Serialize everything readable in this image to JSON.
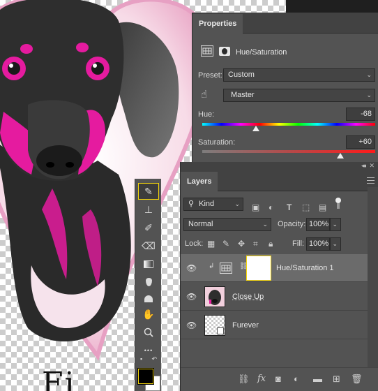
{
  "canvas": {
    "title_fragment": "Fi",
    "colors": {
      "magenta": "#e51b9f",
      "dog": "#2b2b2b",
      "heart": "#f3c6d8",
      "heart_border": "#e08ab4"
    }
  },
  "toolbar": {
    "tools": [
      {
        "name": "brush-tool-icon",
        "glyph": "✎"
      },
      {
        "name": "clone-stamp-icon",
        "glyph": "⊥"
      },
      {
        "name": "history-brush-icon",
        "glyph": "✐"
      },
      {
        "name": "eraser-icon",
        "glyph": "⌫"
      },
      {
        "name": "gradient-icon",
        "glyph": "▭"
      },
      {
        "name": "blur-icon",
        "glyph": "💧"
      },
      {
        "name": "dodge-icon",
        "glyph": "◖"
      },
      {
        "name": "hand-icon",
        "glyph": "✋"
      },
      {
        "name": "zoom-icon",
        "glyph": "⚲"
      },
      {
        "name": "more-tools-icon",
        "glyph": "•••"
      }
    ]
  },
  "properties": {
    "tab_label": "Properties",
    "adjustment_label": "Hue/Saturation",
    "preset_label": "Preset:",
    "preset_value": "Custom",
    "channel_value": "Master",
    "hue_label": "Hue:",
    "hue_value": "-68",
    "hue_number": -68,
    "saturation_label": "Saturation:",
    "saturation_value": "+60",
    "saturation_number": 60
  },
  "layers": {
    "tab_label": "Layers",
    "filter_value": "Kind",
    "blend_mode": "Normal",
    "opacity_label": "Opacity:",
    "opacity_value": "100%",
    "lock_label": "Lock:",
    "fill_label": "Fill:",
    "fill_value": "100%",
    "rows": [
      {
        "name": "Hue/Saturation 1",
        "selected": true
      },
      {
        "name": "Close Up",
        "selected": false
      },
      {
        "name": "Furever",
        "selected": false
      }
    ],
    "footer_icons": [
      "link-icon",
      "fx-icon",
      "mask-icon",
      "adjustment-icon",
      "folder-icon",
      "new-layer-icon",
      "trash-icon"
    ],
    "fx_label": "fx"
  }
}
